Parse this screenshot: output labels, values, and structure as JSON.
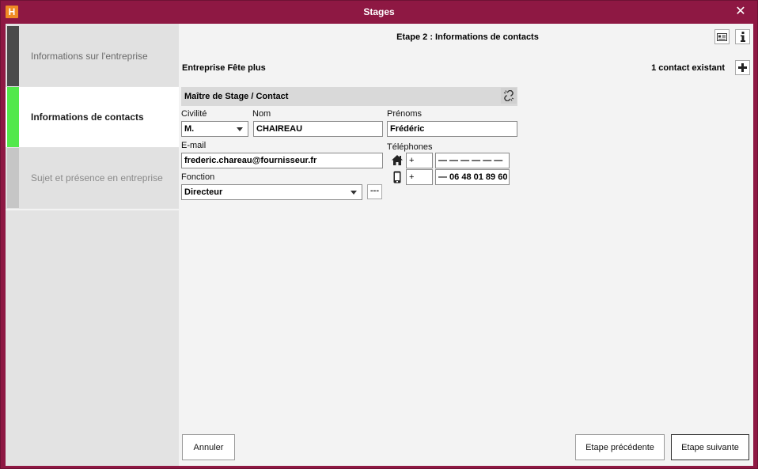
{
  "window": {
    "title": "Stages",
    "logo_letter": "H"
  },
  "sidebar": {
    "steps": [
      {
        "label": "Informations sur l'entreprise",
        "state": "done"
      },
      {
        "label": "Informations de contacts",
        "state": "active"
      },
      {
        "label": "Sujet et présence en entreprise",
        "state": "pending"
      }
    ]
  },
  "main": {
    "step_title": "Etape 2 : Informations de contacts",
    "company_name": "Entreprise Fête plus",
    "contact_count": "1 contact existant",
    "section_title": "Maître de Stage / Contact",
    "form": {
      "civilite_label": "Civilité",
      "civilite_value": "M.",
      "nom_label": "Nom",
      "nom_value": "CHAIREAU",
      "prenoms_label": "Prénoms",
      "prenoms_value": "Frédéric",
      "email_label": "E-mail",
      "email_value": "frederic.chareau@fournisseur.fr",
      "fonction_label": "Fonction",
      "fonction_value": "Directeur",
      "ellipsis_label": "---",
      "telephones_label": "Téléphones",
      "phone_home_prefix": "+",
      "phone_home_value": "— — — — — —",
      "phone_mobile_prefix": "+",
      "phone_mobile_value": "— 06 48 01 89 60"
    }
  },
  "buttons": {
    "cancel": "Annuler",
    "previous": "Etape précédente",
    "next": "Etape suivante"
  },
  "colors": {
    "titlebar": "#8e1843",
    "step_done": "#4a4a4a",
    "step_active": "#52e84b",
    "step_pending": "#c6c6c6"
  }
}
